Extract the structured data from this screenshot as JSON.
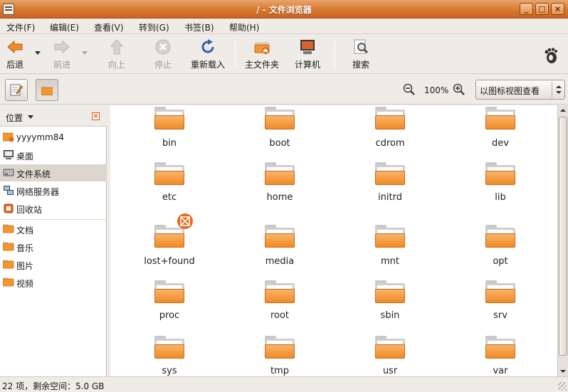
{
  "window": {
    "title": "/ - 文件浏览器",
    "minimize": "_",
    "maximize": "□",
    "close": "×"
  },
  "menu": [
    "文件(F)",
    "编辑(E)",
    "查看(V)",
    "转到(G)",
    "书签(B)",
    "帮助(H)"
  ],
  "toolbar": {
    "back": "后退",
    "forward": "前进",
    "up": "向上",
    "stop": "停止",
    "reload": "重新载入",
    "home": "主文件夹",
    "computer": "计算机",
    "search": "搜索"
  },
  "location": {
    "zoom": "100%",
    "view_mode": "以图标视图查看"
  },
  "sidebar": {
    "title": "位置",
    "places": [
      "yyyymm84",
      "桌面",
      "文件系统",
      "网络服务器",
      "回收站"
    ],
    "bookmarks": [
      "文档",
      "音乐",
      "图片",
      "视频"
    ],
    "selected": "文件系统"
  },
  "files": [
    "bin",
    "boot",
    "cdrom",
    "dev",
    "etc",
    "home",
    "initrd",
    "lib",
    "lost+found",
    "media",
    "mnt",
    "opt",
    "proc",
    "root",
    "sbin",
    "srv",
    "sys",
    "tmp",
    "usr",
    "var"
  ],
  "status": "22 项，剩余空间：5.0 GB",
  "colors": {
    "accent": "#d8782f",
    "folder": "#f08a26"
  }
}
